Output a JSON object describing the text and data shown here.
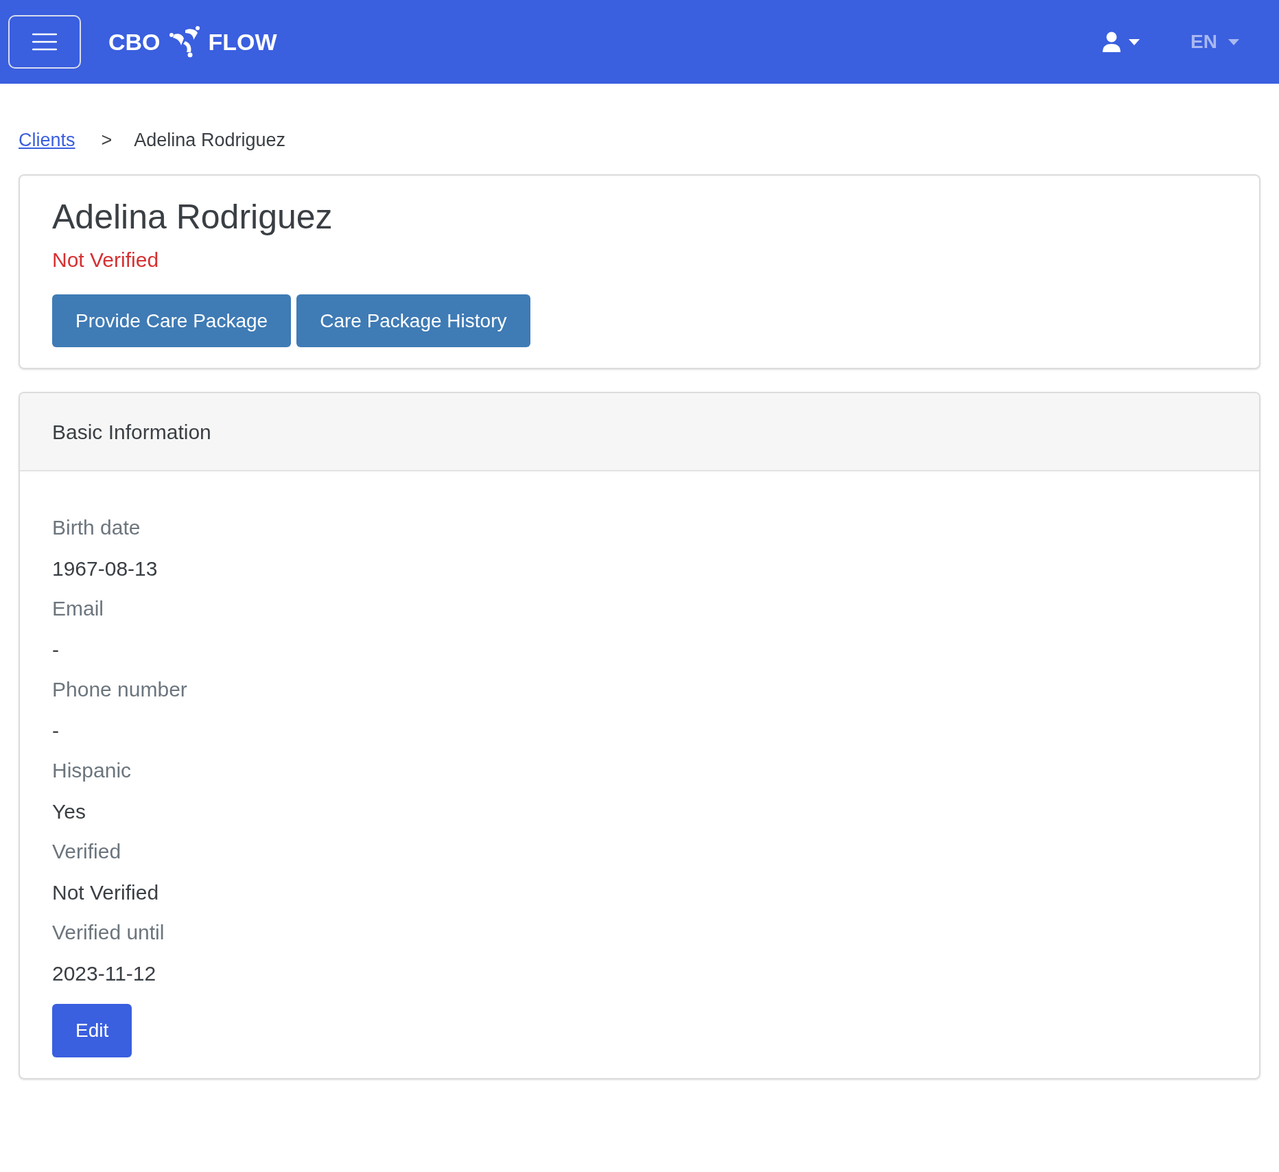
{
  "navbar": {
    "logo_left": "CBO",
    "logo_right": "FLOW",
    "language": "EN"
  },
  "breadcrumb": [
    {
      "label": "Clients",
      "kind": "link"
    },
    {
      "label": ">",
      "kind": "separator"
    },
    {
      "label": "Adelina Rodriguez",
      "kind": "current"
    }
  ],
  "client": {
    "name": "Adelina Rodriguez",
    "status": "Not Verified",
    "verified": false,
    "buttons": [
      "Provide Care Package",
      "Care Package History"
    ]
  },
  "basic_information": {
    "title": "Basic Information",
    "fields": [
      {
        "label": "Birth date",
        "value": "1967-08-13"
      },
      {
        "label": "Email",
        "value": "-"
      },
      {
        "label": "Phone number",
        "value": "-"
      },
      {
        "label": "Hispanic",
        "value": "Yes"
      },
      {
        "label": "Verified",
        "value": "Not Verified"
      },
      {
        "label": "Verified until",
        "value": "2023-11-12"
      }
    ],
    "button": "Edit"
  }
}
